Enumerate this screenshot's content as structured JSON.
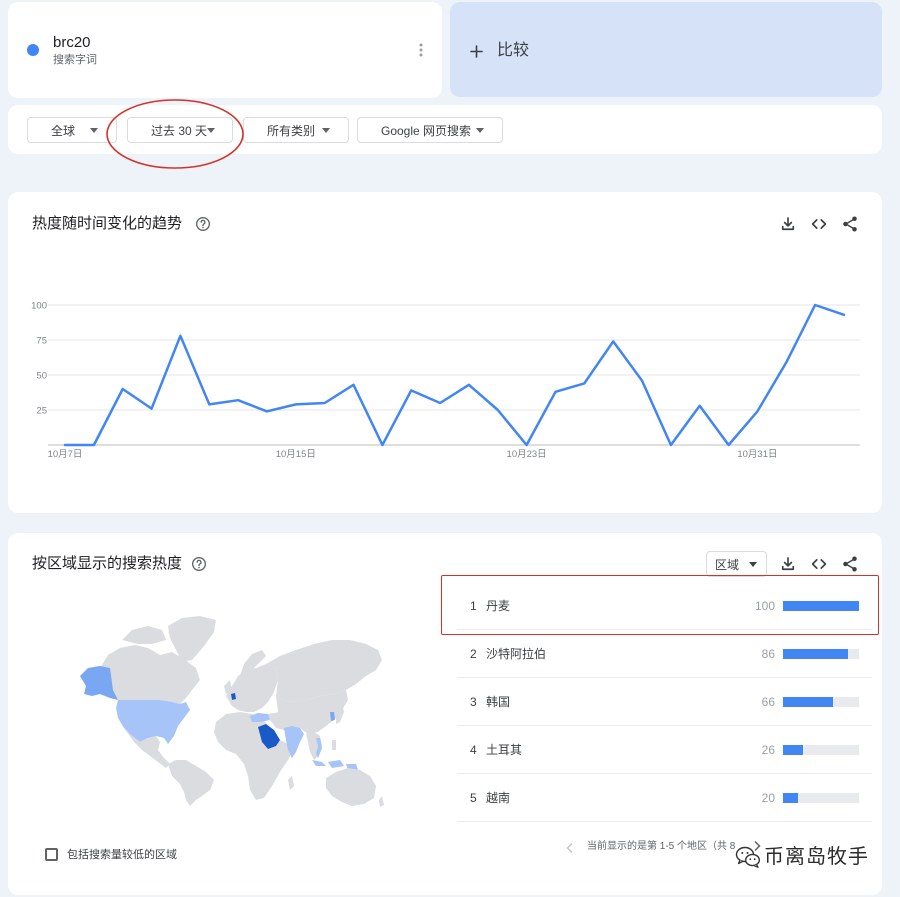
{
  "theme": {
    "page_background": "#eef2f9",
    "compare_background": "#d6e2f8",
    "accent": "#4285f4",
    "annotation_color": "#d3322b"
  },
  "search_term": {
    "name": "brc20",
    "type_label": "搜索字词",
    "color": "#4285f4"
  },
  "compare": {
    "label": "比较"
  },
  "filters": {
    "region": "全球",
    "time_range": "过去 30 天",
    "category": "所有类别",
    "search_type": "Google 网页搜索"
  },
  "toolbar_icons": [
    "download-icon",
    "embed-icon",
    "share-icon"
  ],
  "chart_data": {
    "type": "line",
    "title": "热度随时间变化的趋势",
    "x": [
      "10月7日",
      "10月8日",
      "10月9日",
      "10月10日",
      "10月11日",
      "10月12日",
      "10月13日",
      "10月14日",
      "10月15日",
      "10月16日",
      "10月17日",
      "10月18日",
      "10月19日",
      "10月20日",
      "10月21日",
      "10月22日",
      "10月23日",
      "10月24日",
      "10月25日",
      "10月26日",
      "10月27日",
      "10月28日",
      "10月29日",
      "10月30日",
      "10月31日",
      "11月1日",
      "11月2日",
      "11月3日"
    ],
    "x_ticks": [
      "10月7日",
      "10月15日",
      "10月23日",
      "10月31日"
    ],
    "y_ticks": [
      25,
      50,
      75,
      100
    ],
    "ylim": [
      0,
      100
    ],
    "grid": true,
    "series": [
      {
        "color": "#4285f4",
        "values": [
          0,
          0,
          40,
          26,
          78,
          29,
          32,
          24,
          29,
          30,
          43,
          0,
          39,
          30,
          43,
          25,
          0,
          38,
          44,
          74,
          46,
          0,
          28,
          0,
          24,
          59,
          100,
          93
        ]
      }
    ]
  },
  "interest_by_region": {
    "title": "按区域显示的搜索热度",
    "resolution_label": "区域",
    "bar_color": "#4285f4",
    "regions": [
      {
        "rank": "1",
        "name": "丹麦",
        "value": 100
      },
      {
        "rank": "2",
        "name": "沙特阿拉伯",
        "value": 86
      },
      {
        "rank": "3",
        "name": "韩国",
        "value": 66
      },
      {
        "rank": "4",
        "name": "土耳其",
        "value": 26
      },
      {
        "rank": "5",
        "name": "越南",
        "value": 20
      }
    ],
    "map_colors": {
      "land": "#dadce0",
      "low": "#a6c4f8",
      "mid": "#7aa7f2",
      "high": "#1a5ac7"
    },
    "include_low_volume_label": "包括搜索量较低的区域",
    "include_low_volume_checked": false,
    "pagination_text": "当前显示的是第 1-5 个地区（共 8"
  },
  "watermark": {
    "text": "币离岛牧手"
  }
}
